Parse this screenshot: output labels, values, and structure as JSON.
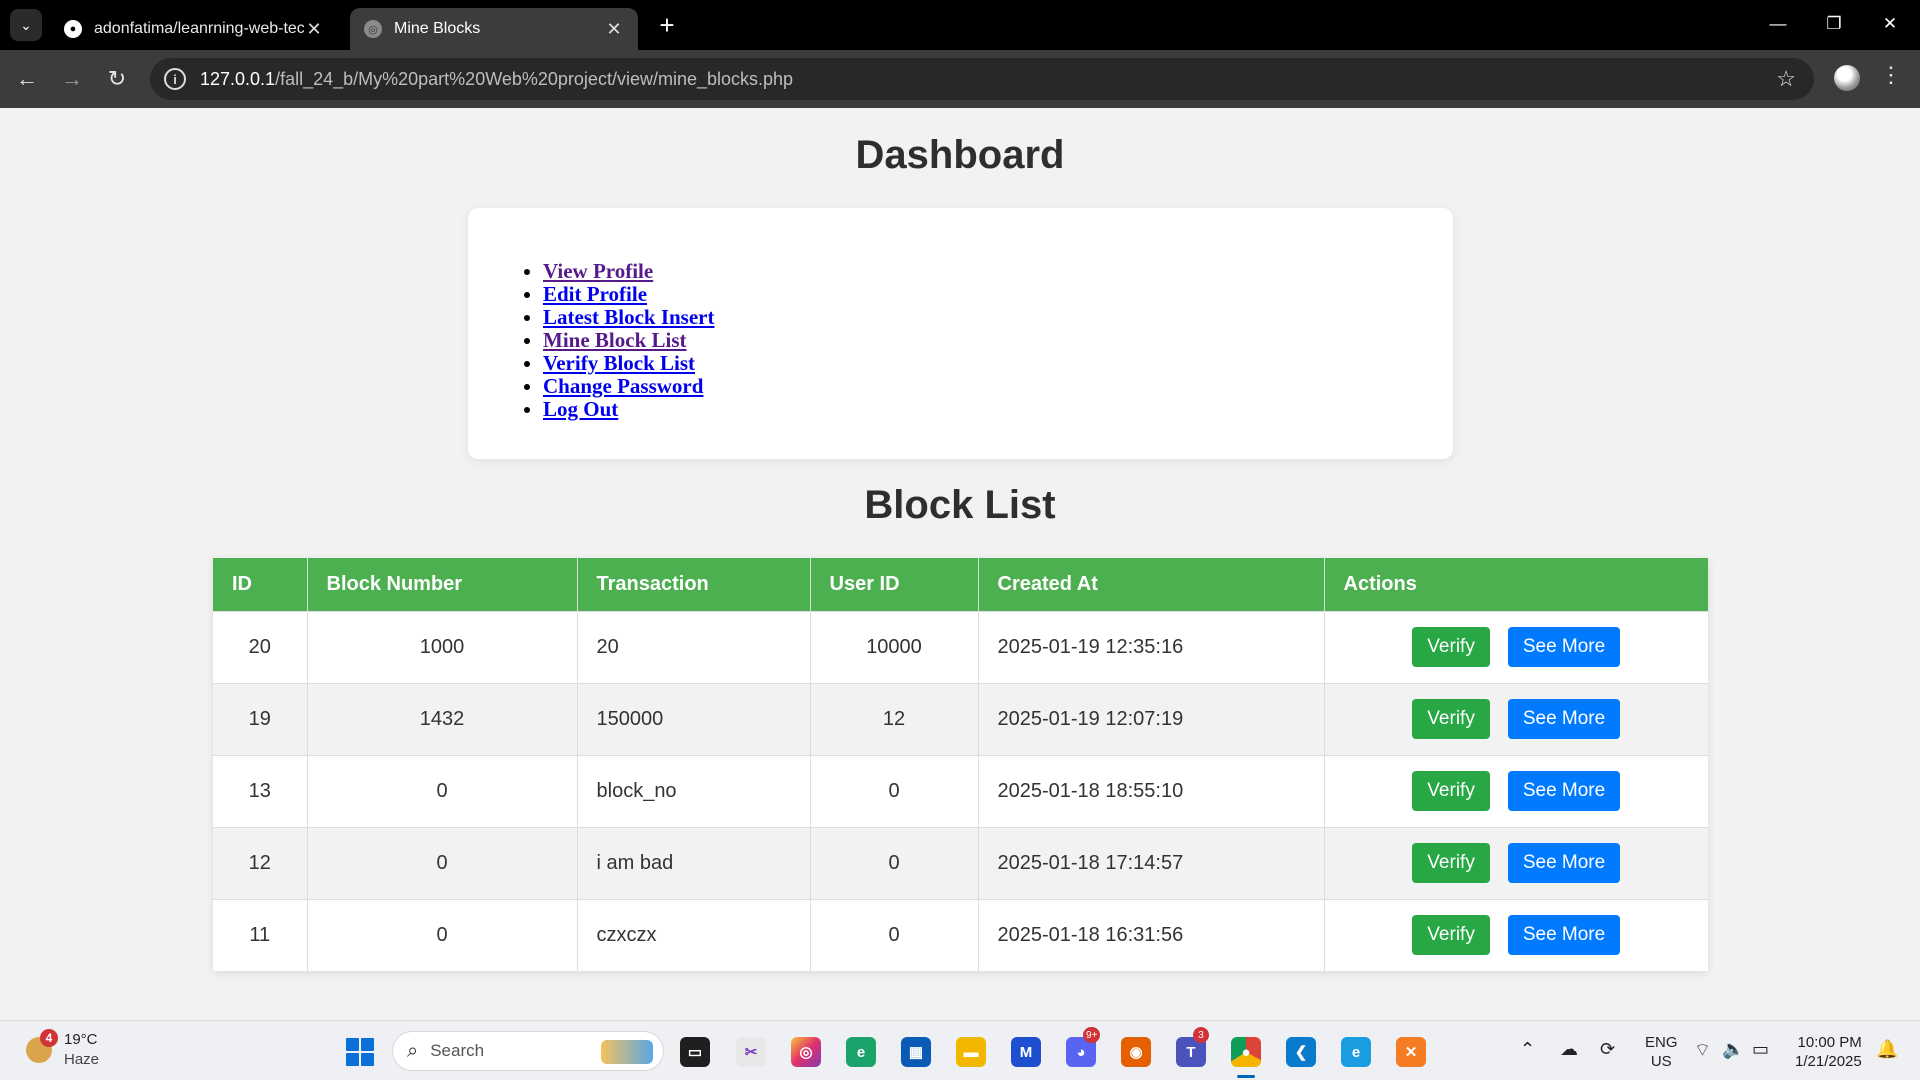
{
  "browser": {
    "tabs": [
      {
        "title": "adonfatima/leanrning-web-tech",
        "active": false
      },
      {
        "title": "Mine Blocks",
        "active": true
      }
    ],
    "url_host": "127.0.0.1",
    "url_path": "/fall_24_b/My%20part%20Web%20project/view/mine_blocks.php"
  },
  "page": {
    "title": "Dashboard",
    "nav": [
      {
        "label": "View Profile",
        "visited": true
      },
      {
        "label": "Edit Profile",
        "visited": false
      },
      {
        "label": "Latest Block Insert",
        "visited": false
      },
      {
        "label": "Mine Block List",
        "visited": true
      },
      {
        "label": "Verify Block List",
        "visited": false
      },
      {
        "label": "Change Password",
        "visited": false
      },
      {
        "label": "Log Out",
        "visited": false
      }
    ],
    "list_title": "Block List",
    "columns": [
      "ID",
      "Block Number",
      "Transaction",
      "User ID",
      "Created At",
      "Actions"
    ],
    "rows": [
      {
        "id": "20",
        "block_number": "1000",
        "transaction": "20",
        "user_id": "10000",
        "created_at": "2025-01-19 12:35:16"
      },
      {
        "id": "19",
        "block_number": "1432",
        "transaction": "150000",
        "user_id": "12",
        "created_at": "2025-01-19 12:07:19"
      },
      {
        "id": "13",
        "block_number": "0",
        "transaction": "block_no",
        "user_id": "0",
        "created_at": "2025-01-18 18:55:10"
      },
      {
        "id": "12",
        "block_number": "0",
        "transaction": "i am bad",
        "user_id": "0",
        "created_at": "2025-01-18 17:14:57"
      },
      {
        "id": "11",
        "block_number": "0",
        "transaction": "czxczx",
        "user_id": "0",
        "created_at": "2025-01-18 16:31:56"
      }
    ],
    "verify_label": "Verify",
    "see_more_label": "See More",
    "colors": {
      "header_green": "#4caf50",
      "verify_green": "#28a745",
      "see_more_blue": "#007bff"
    }
  },
  "taskbar": {
    "weather_temp": "19°C",
    "weather_desc": "Haze",
    "weather_badge": "4",
    "search_placeholder": "Search",
    "discord_badge": "9+",
    "teams_badge": "3",
    "lang_line1": "ENG",
    "lang_line2": "US",
    "time": "10:00 PM",
    "date": "1/21/2025"
  }
}
